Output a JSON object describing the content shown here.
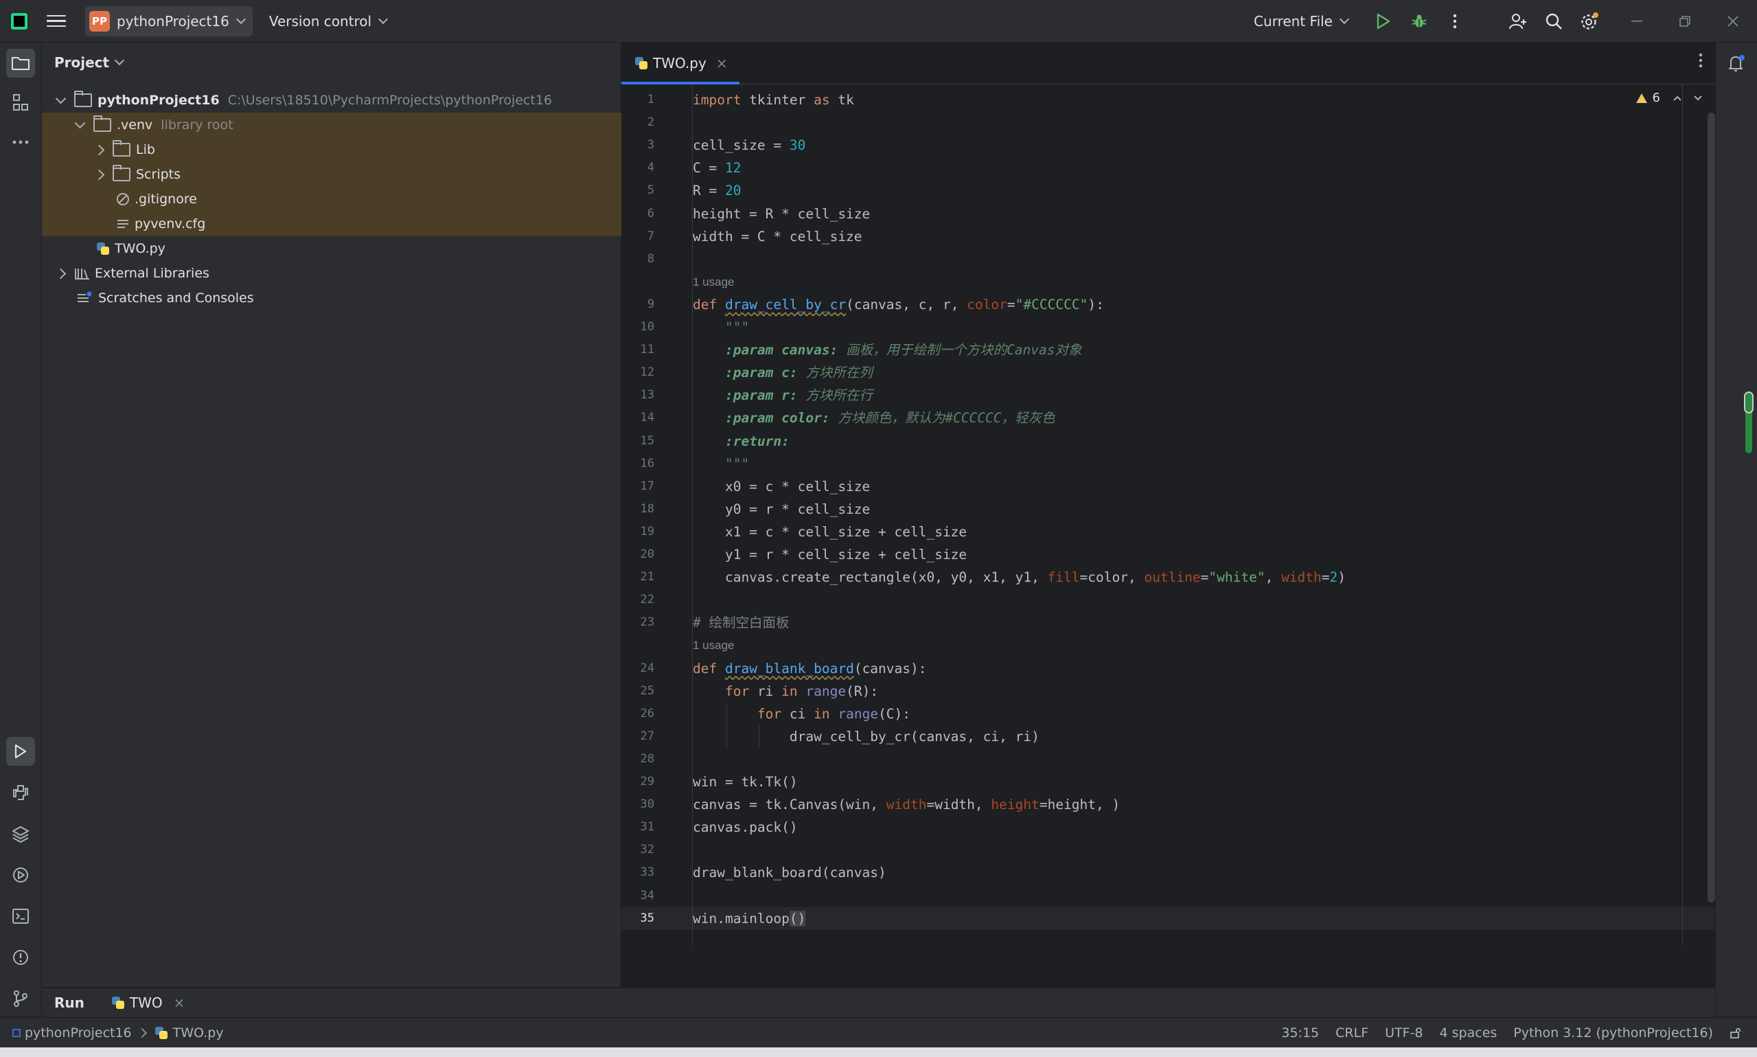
{
  "titlebar": {
    "project_badge": "PP",
    "project_name": "pythonProject16",
    "version_control": "Version control",
    "run_config": "Current File"
  },
  "project_panel": {
    "title": "Project",
    "tree": [
      {
        "label": "pythonProject16",
        "path": "C:\\Users\\18510\\PycharmProjects\\pythonProject16"
      },
      {
        "label": ".venv",
        "note": "library root"
      },
      {
        "label": "Lib"
      },
      {
        "label": "Scripts"
      },
      {
        "label": ".gitignore"
      },
      {
        "label": "pyvenv.cfg"
      },
      {
        "label": "TWO.py"
      },
      {
        "label": "External Libraries"
      },
      {
        "label": "Scratches and Consoles"
      }
    ]
  },
  "editor": {
    "tab_label": "TWO.py",
    "inspection_count": "6",
    "usage_hint_1": "1 usage",
    "usage_hint_2": "1 usage",
    "line_numbers": [
      "1",
      "2",
      "3",
      "4",
      "5",
      "6",
      "7",
      "8",
      "9",
      "10",
      "11",
      "12",
      "13",
      "14",
      "15",
      "16",
      "17",
      "18",
      "19",
      "20",
      "21",
      "22",
      "23",
      "24",
      "25",
      "26",
      "27",
      "28",
      "29",
      "30",
      "31",
      "32",
      "33",
      "34",
      "35"
    ],
    "code": [
      "import tkinter as tk",
      "",
      "cell_size = 30",
      "C = 12",
      "R = 20",
      "height = R * cell_size",
      "width = C * cell_size",
      "",
      "def draw_cell_by_cr(canvas, c, r, color=\"#CCCCCC\"):",
      "    \"\"\"",
      "    :param canvas: 画板，用于绘制一个方块的Canvas对象",
      "    :param c: 方块所在列",
      "    :param r: 方块所在行",
      "    :param color: 方块颜色，默认为#CCCCCC，轻灰色",
      "    :return:",
      "    \"\"\"",
      "    x0 = c * cell_size",
      "    y0 = r * cell_size",
      "    x1 = c * cell_size + cell_size",
      "    y1 = r * cell_size + cell_size",
      "    canvas.create_rectangle(x0, y0, x1, y1, fill=color, outline=\"white\", width=2)",
      "",
      "# 绘制空白面板",
      "def draw_blank_board(canvas):",
      "    for ri in range(R):",
      "        for ci in range(C):",
      "            draw_cell_by_cr(canvas, ci, ri)",
      "",
      "win = tk.Tk()",
      "canvas = tk.Canvas(win, width=width, height=height, )",
      "canvas.pack()",
      "",
      "draw_blank_board(canvas)",
      "",
      "win.mainloop()"
    ]
  },
  "run_panel": {
    "title": "Run",
    "tab_label": "TWO"
  },
  "status_bar": {
    "breadcrumb_project": "pythonProject16",
    "breadcrumb_file": "TWO.py",
    "position": "35:15",
    "line_ending": "CRLF",
    "encoding": "UTF-8",
    "indent": "4 spaces",
    "interpreter": "Python 3.12 (pythonProject16)"
  },
  "icons": [
    "main-menu-icon",
    "run-icon",
    "debug-icon",
    "more-vert-icon",
    "add-user-icon",
    "search-icon",
    "settings-icon",
    "minimize-icon",
    "restore-icon",
    "close-icon",
    "folder-icon",
    "structure-icon",
    "more-horiz-icon",
    "run-tool-icon",
    "python-console-icon",
    "layers-icon",
    "services-icon",
    "terminal-icon",
    "problems-icon",
    "git-icon",
    "notifications-icon"
  ],
  "colors": {
    "accent": "#3574f0",
    "keyword": "#cf8e6d",
    "number": "#2aacb8",
    "string": "#6aab73",
    "function": "#56a8f5",
    "highlight": "#4a3e26",
    "warning": "#f2c55c"
  }
}
